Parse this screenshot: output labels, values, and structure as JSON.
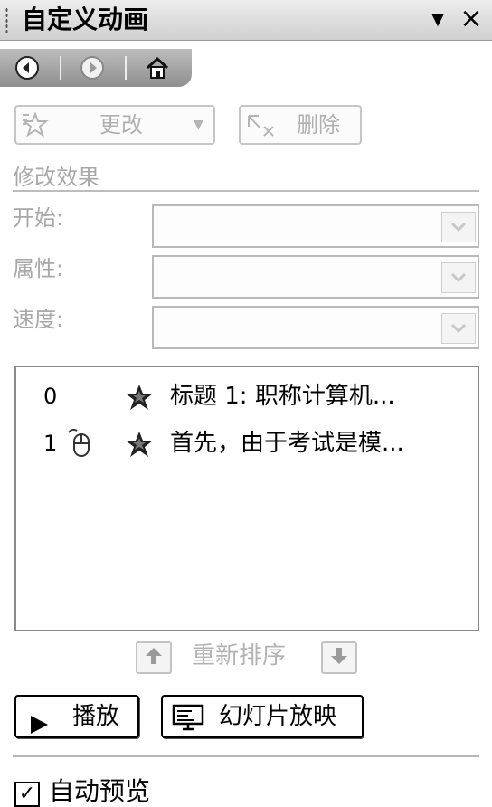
{
  "pane": {
    "title": "自定义动画",
    "menu_icon": "dropdown-triangle-icon",
    "close_icon": "close-icon"
  },
  "nav": {
    "back_icon": "back-icon",
    "forward_icon": "forward-icon",
    "home_icon": "home-icon"
  },
  "toolbar": {
    "change_label": "更改",
    "delete_label": "删除"
  },
  "modify": {
    "heading": "修改效果",
    "start_label": "开始:",
    "property_label": "属性:",
    "speed_label": "速度:"
  },
  "effects": [
    {
      "index": "0",
      "trigger": "",
      "text": "标题 1: 职称计算机..."
    },
    {
      "index": "1",
      "trigger": "mouse-click-icon",
      "text": "首先，由于考试是模..."
    }
  ],
  "reorder": {
    "label": "重新排序"
  },
  "buttons": {
    "play_label": "播放",
    "slideshow_label": "幻灯片放映"
  },
  "autopreview": {
    "label": "自动预览",
    "checked": true,
    "check_mark": "✓"
  },
  "colors": {
    "disabled_text": "#b0b0b0",
    "panel_gray": "#8f8f8f"
  }
}
